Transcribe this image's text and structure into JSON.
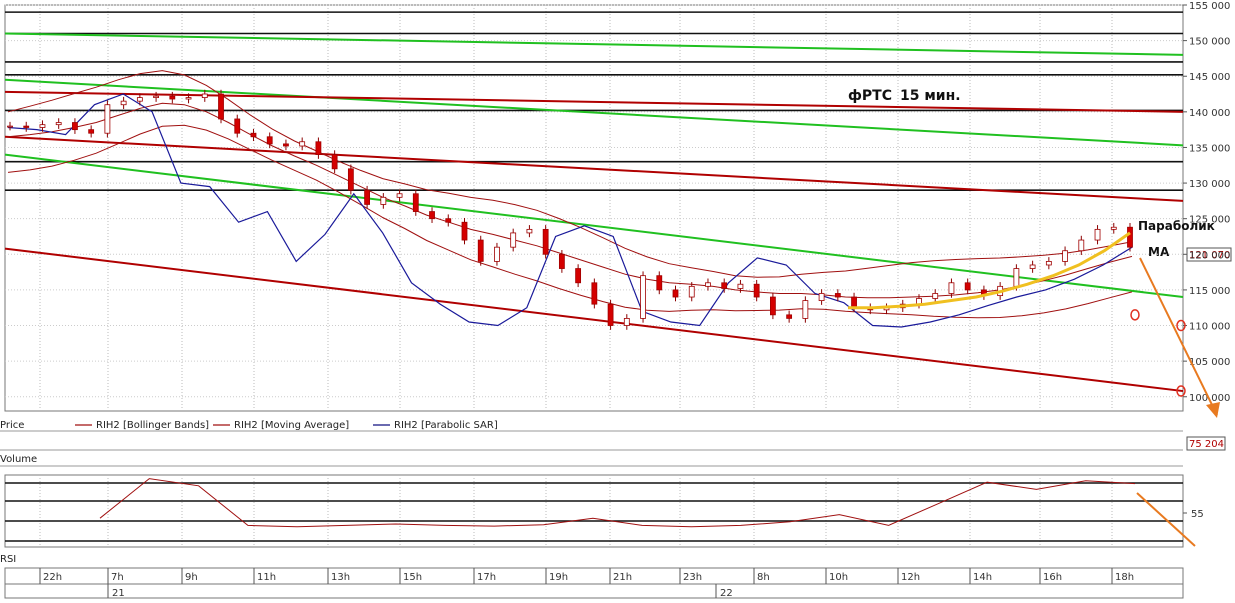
{
  "chart_data": [
    {
      "type": "line",
      "panel": "price",
      "title": "фРТС",
      "subtitle": "15 мин.",
      "ylim": [
        98000,
        155000
      ],
      "y_ticks": [
        {
          "value": 100000,
          "label": "100 000"
        },
        {
          "value": 105000,
          "label": "105 000"
        },
        {
          "value": 110000,
          "label": "110 000"
        },
        {
          "value": 115000,
          "label": "115 000"
        },
        {
          "value": 120000,
          "label": "120 000"
        },
        {
          "value": 125000,
          "label": "125 000"
        },
        {
          "value": 130000,
          "label": "130 000"
        },
        {
          "value": 135000,
          "label": "135 000"
        },
        {
          "value": 140000,
          "label": "140 000"
        },
        {
          "value": 145000,
          "label": "145 000"
        },
        {
          "value": 150000,
          "label": "150 000"
        },
        {
          "value": 155000,
          "label": "155 000"
        }
      ],
      "last_price_label": "121 070",
      "legend": [
        {
          "label": "Price",
          "color": "#cc0000"
        },
        {
          "label": "RIH2 [Bollinger Bands]",
          "color": "#a01010"
        },
        {
          "label": "RIH2 [Moving Average]",
          "color": "#a01010"
        },
        {
          "label": "RIH2 [Parabolic SAR]",
          "color": "#101080"
        }
      ],
      "annotations": [
        "Параболик",
        "МА"
      ],
      "series": [
        {
          "values": [
            138000,
            137800,
            138200,
            138500,
            137500,
            137000,
            141000,
            141500,
            142000,
            142200,
            141800,
            142000,
            142500,
            139000,
            137000,
            136500,
            135500,
            135200,
            135800,
            134000,
            132000,
            129000,
            127000,
            128000,
            128500,
            126000,
            125000,
            124500,
            122000,
            119000,
            121000,
            123000,
            123500,
            120000,
            118000,
            116000,
            113000,
            110000,
            111000,
            117000,
            115000,
            114000,
            115500,
            116000,
            115200,
            115800,
            114000,
            111500,
            111000,
            113500,
            114500,
            114000,
            112500,
            112200,
            112500,
            113000,
            113800,
            114500,
            116000,
            115000,
            114200,
            115500,
            118000,
            118500,
            119000,
            120500,
            122000,
            123500,
            123800,
            121000
          ]
        },
        {
          "values": [
            136500,
            136800,
            137200,
            137800,
            138500,
            139500,
            140500,
            141200,
            141000,
            140000,
            138500,
            136800,
            135200,
            133800,
            132500,
            131000,
            129500,
            128000,
            126800,
            125500,
            124500,
            123500,
            122800,
            122000,
            121200,
            120200,
            119200,
            118200,
            117200,
            116500,
            116000,
            115800,
            115500,
            115000,
            114700,
            114500,
            114500,
            114300,
            114000,
            113900,
            113900,
            114000,
            114100,
            114300,
            114600,
            115000,
            115600,
            116300,
            117100,
            118000,
            118900,
            119700
          ]
        },
        {
          "values": [
            137800,
            137500,
            136800,
            141000,
            142500,
            140000,
            130000,
            129500,
            124500,
            126000,
            119000,
            122800,
            128500,
            123000,
            116000,
            113000,
            110500,
            110000,
            112500,
            122500,
            124000,
            122500,
            112000,
            110500,
            110000,
            116000,
            119500,
            118500,
            114500,
            113200,
            110000,
            109800,
            110500,
            111500,
            112800,
            114000,
            115000,
            116500,
            118500,
            121000
          ]
        },
        {
          "values": [
            112500,
            112500,
            112700,
            113000,
            113500,
            114000,
            114800,
            115800,
            117000,
            118500,
            120500,
            123000
          ]
        }
      ]
    },
    {
      "type": "bar",
      "panel": "volume",
      "title": "Volume",
      "last_value_label": "75 204"
    },
    {
      "type": "line",
      "panel": "rsi",
      "title": "RSI",
      "y_ticks": [
        {
          "value": 55,
          "label": "55"
        }
      ],
      "x_ticks": [
        "22h",
        "7h",
        "9h",
        "11h",
        "13h",
        "15h",
        "17h",
        "19h",
        "21h",
        "23h",
        "8h",
        "10h",
        "12h",
        "14h",
        "16h",
        "18h"
      ],
      "date_labels": [
        "21",
        "22"
      ],
      "series": [
        {
          "values": [
            40,
            95,
            85,
            30,
            28,
            30,
            32,
            30,
            29,
            31,
            40,
            30,
            28,
            30,
            35,
            45,
            30,
            60,
            90,
            80,
            92,
            88
          ]
        }
      ]
    }
  ]
}
